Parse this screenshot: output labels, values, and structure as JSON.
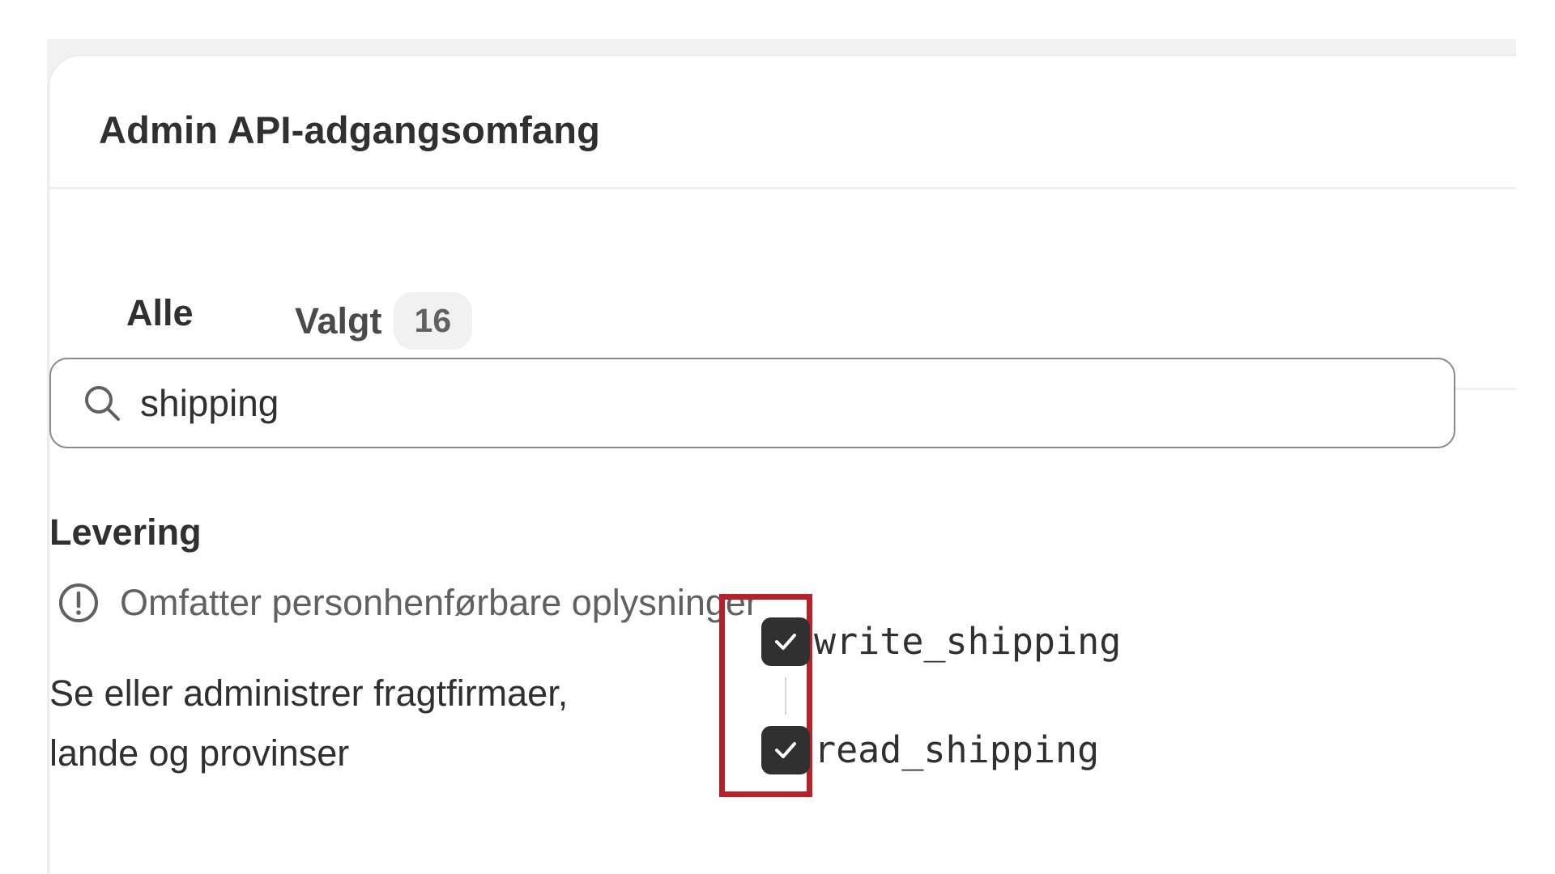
{
  "card": {
    "title": "Admin API-adgangsomfang"
  },
  "tabs": [
    {
      "label": "Alle",
      "active": true
    },
    {
      "label": "Valgt",
      "count": "16",
      "active": false
    }
  ],
  "search": {
    "value": "shipping",
    "icon": "search-icon"
  },
  "section": {
    "title": "Levering",
    "warning": "Omfatter personhenførbare oplysninger",
    "warning_icon": "exclamation-circle-icon",
    "description": "Se eller administrer fragtfirmaer, lande og provinser",
    "scopes": [
      {
        "name": "write_shipping",
        "checked": true
      },
      {
        "name": "read_shipping",
        "checked": true
      }
    ]
  },
  "colors": {
    "checkbox": "#303030",
    "highlight": "#b5222a",
    "text": "#303030",
    "muted": "#616161"
  }
}
